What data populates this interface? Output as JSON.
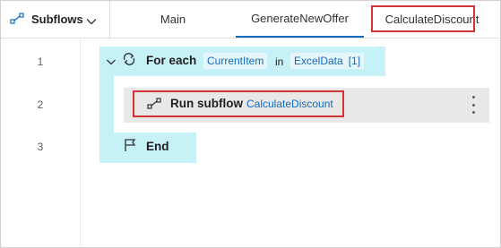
{
  "toolbar": {
    "subflows_label": "Subflows",
    "subflows_icon": "subflow-icon",
    "dropdown_icon": "chevron-down-icon"
  },
  "tabs": [
    {
      "label": "Main",
      "active": false
    },
    {
      "label": "GenerateNewOffer",
      "active": true
    },
    {
      "label": "CalculateDiscount",
      "active": false,
      "highlighted": true
    }
  ],
  "line_numbers": [
    "1",
    "2",
    "3"
  ],
  "actions": {
    "foreach": {
      "keyword": "For each",
      "variable": "CurrentItem",
      "in_label": "in",
      "collection": "ExcelData",
      "index": "[1]",
      "icon": "loop-icon",
      "expand_icon": "chevron-down-icon"
    },
    "run_subflow": {
      "keyword": "Run subflow",
      "target": "CalculateDiscount",
      "icon": "subflow-icon",
      "more_icon": "more-vertical-icon",
      "highlighted": true
    },
    "end": {
      "keyword": "End",
      "icon": "flag-icon"
    }
  },
  "colors": {
    "loop_block": "#c6f1f6",
    "action_block": "#e9e8e7",
    "link": "#0f6cbd",
    "highlight": "#d13438",
    "active_tab_underline": "#0f6cbd"
  }
}
